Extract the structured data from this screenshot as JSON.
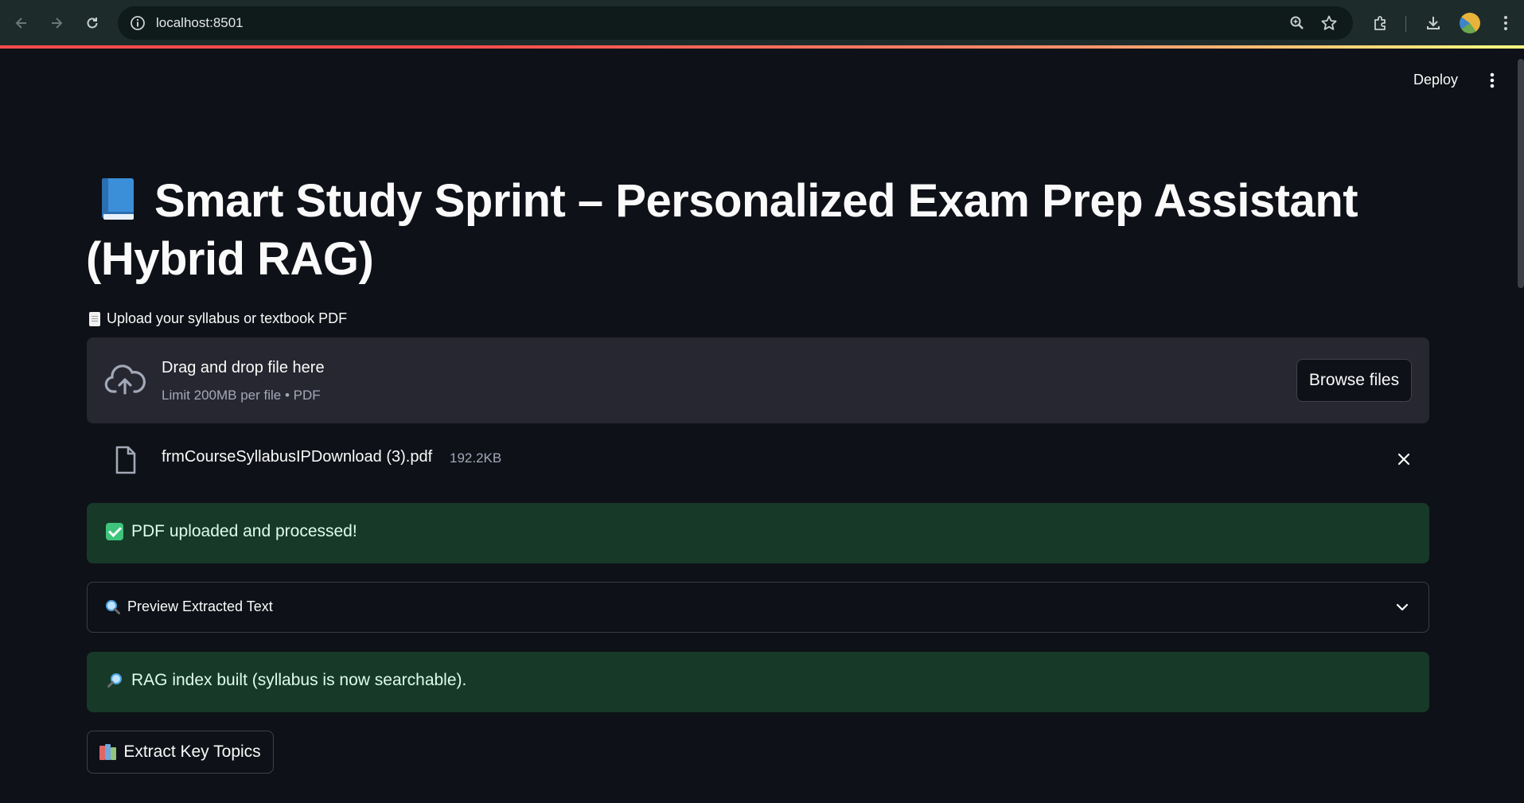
{
  "browser": {
    "url": "localhost:8501",
    "icons": [
      "back-arrow-icon",
      "forward-arrow-icon",
      "reload-icon",
      "site-info-icon",
      "zoom-icon",
      "bookmark-star-icon",
      "extensions-icon",
      "download-icon",
      "profile-avatar",
      "browser-menu-icon"
    ]
  },
  "app": {
    "deploy_label": "Deploy",
    "title": "Smart Study Sprint – Personalized Exam Prep Assistant (Hybrid RAG)",
    "upload": {
      "label": "Upload your syllabus or textbook PDF",
      "dropzone_title": "Drag and drop file here",
      "dropzone_subtitle": "Limit 200MB per file • PDF",
      "browse_label": "Browse files"
    },
    "uploaded_file": {
      "name": "frmCourseSyllabusIPDownload (3).pdf",
      "size": "192.2KB"
    },
    "success_message": "PDF uploaded and processed!",
    "preview_label": "Preview Extracted Text",
    "rag_message": "RAG index built (syllabus is now searchable).",
    "extract_button": "Extract Key Topics"
  },
  "colors": {
    "background": "#0e1117",
    "dropzone": "#262730",
    "success_bg": "#173928",
    "success_text": "#dffde9",
    "accent": "#ff4b4b"
  }
}
